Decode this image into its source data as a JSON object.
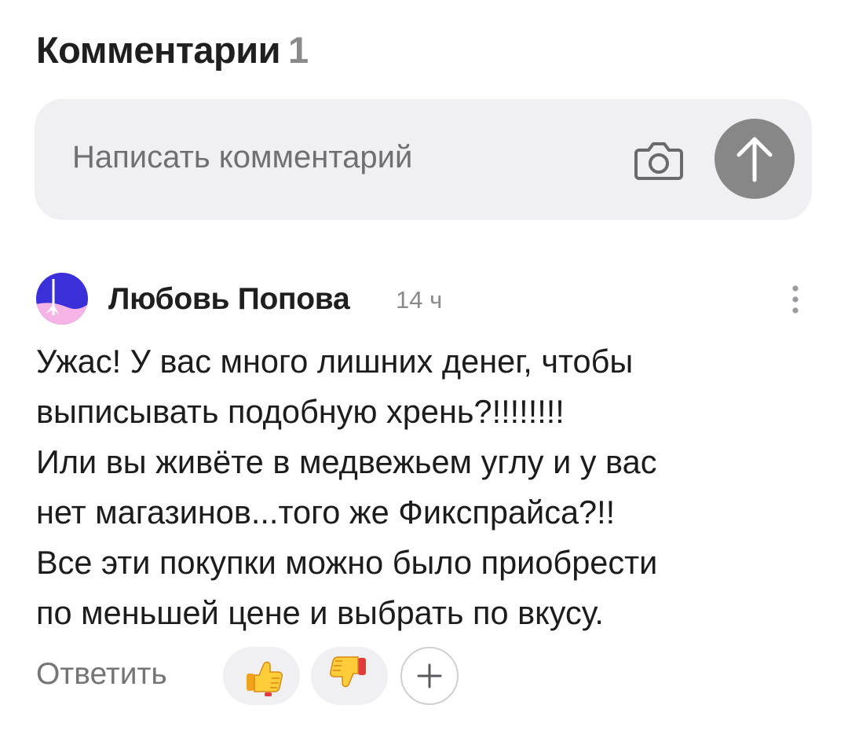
{
  "header": {
    "title": "Комментарии",
    "count": "1"
  },
  "composer": {
    "placeholder": "Написать комментарий",
    "camera_icon": "camera-icon",
    "send_icon": "arrow-up-icon",
    "send_color": "#878787"
  },
  "comment": {
    "author": "Любовь Попова",
    "time": "14 ч",
    "lines": [
      "Ужас! У вас много лишних денег, чтобы",
      "выписывать подобную хрень?!!!!!!!!",
      "Или вы живёте в медвежьем углу и у вас",
      "нет магазинов...того же Фикспрайса?!!",
      "Все эти покупки можно было приобрести",
      "по меньшей цене и выбрать по вкусу."
    ],
    "reply_label": "Ответить",
    "reactions": [
      {
        "icon": "thumbs-up-icon"
      },
      {
        "icon": "thumbs-down-icon"
      }
    ],
    "add_reaction_icon": "plus-icon",
    "more_icon": "vertical-dots-icon",
    "avatar_colors": [
      "#3b2fd9",
      "#f6b3e6"
    ]
  }
}
